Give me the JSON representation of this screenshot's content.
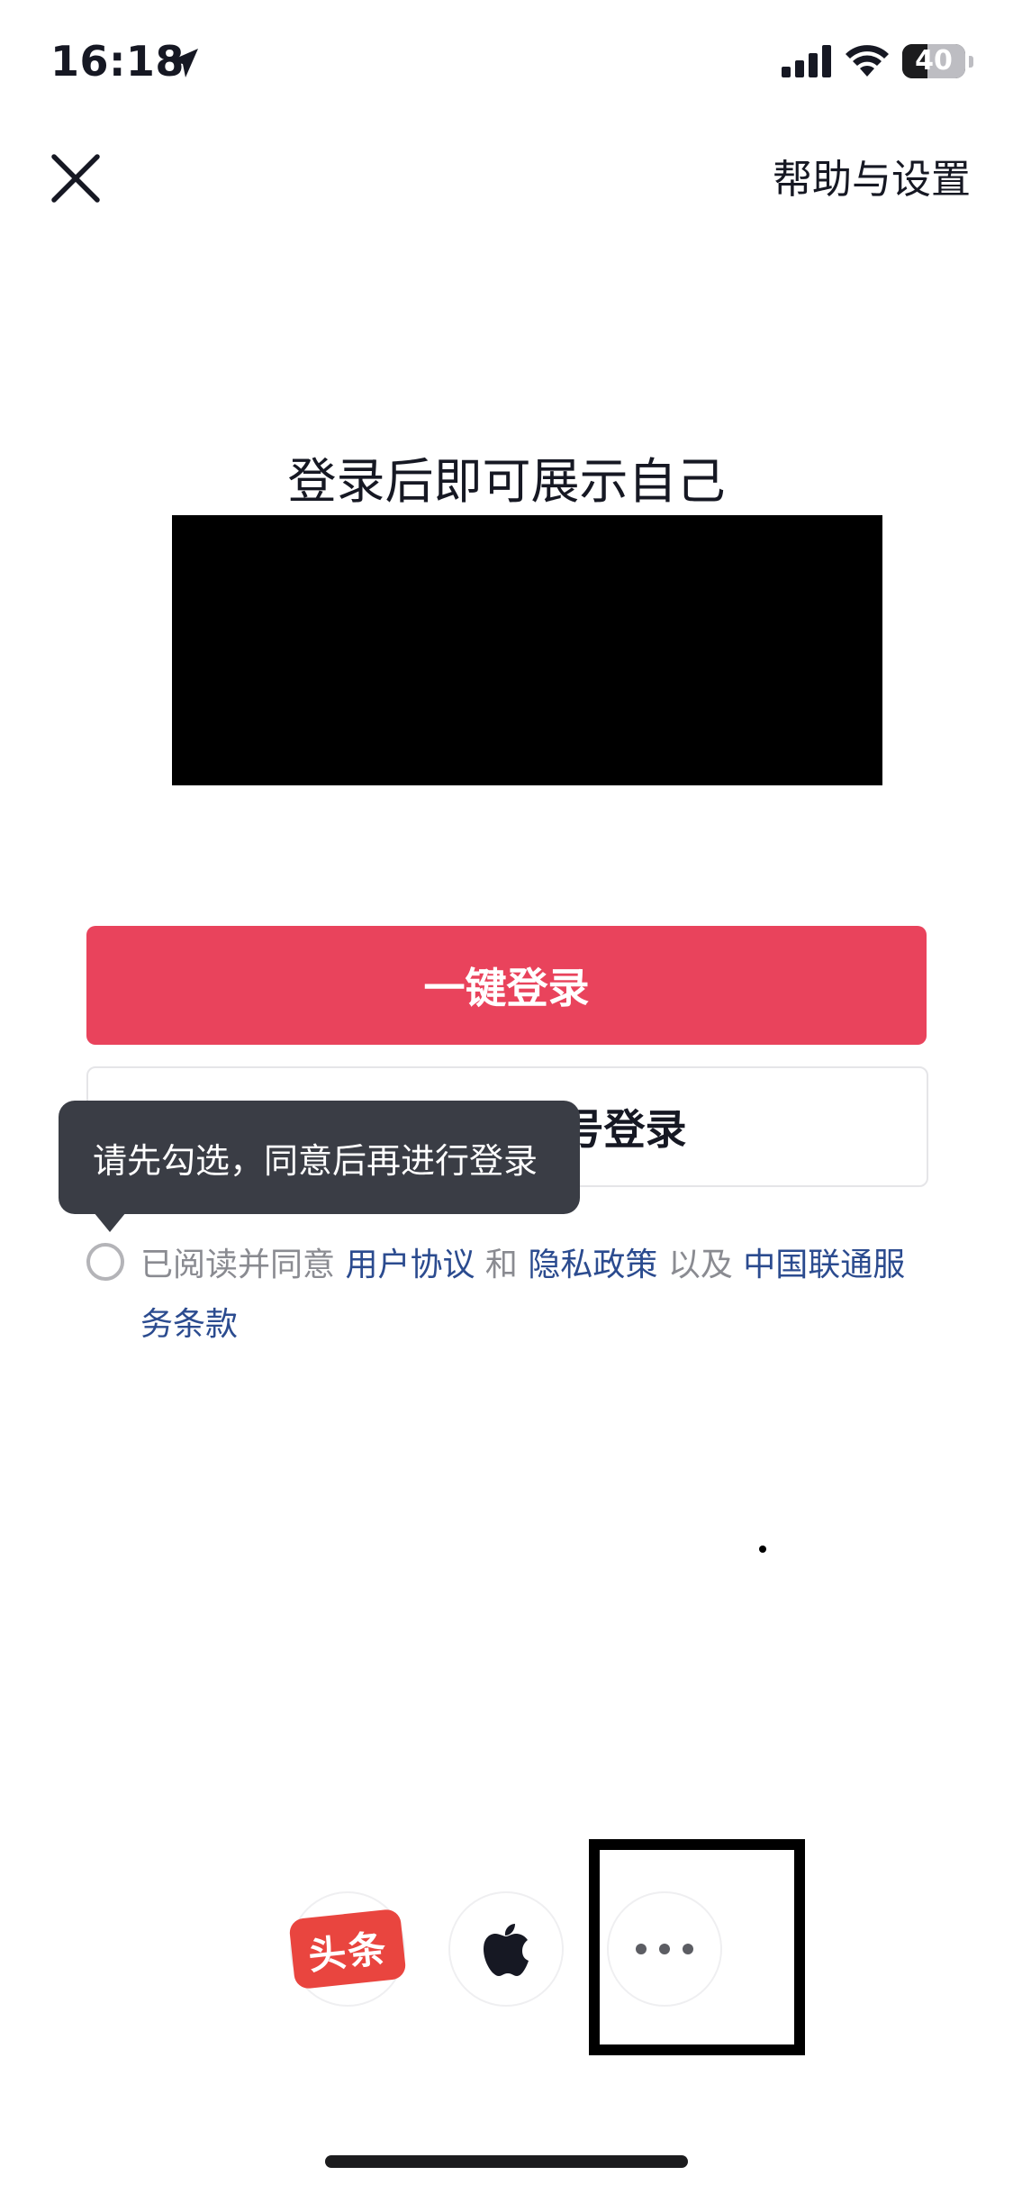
{
  "status_bar": {
    "time": "16:18",
    "battery_level": "40",
    "icons": [
      "location-arrow-icon",
      "cellular-signal-icon",
      "wifi-icon",
      "battery-icon"
    ]
  },
  "nav": {
    "close_icon": "close-icon",
    "help_settings": "帮助与设置"
  },
  "main": {
    "title": "登录后即可展示自己"
  },
  "buttons": {
    "one_click_login": "一键登录",
    "other_login": "号登录"
  },
  "tooltip": {
    "text": "请先勾选，同意后再进行登录"
  },
  "agreement": {
    "prefix": "已阅读并同意 ",
    "user_agreement": "用户协议",
    "and": " 和 ",
    "privacy_policy": "隐私政策",
    "as_well_as": " 以及 ",
    "carrier_terms": "中国联通服务条款"
  },
  "third_party": {
    "toutiao_label": "头条",
    "icons": [
      "toutiao-icon",
      "apple-icon",
      "more-icon"
    ]
  },
  "colors": {
    "primary": "#e9435c",
    "link": "#2b4b8f",
    "tooltip_bg": "#3a3d45",
    "toutiao_red": "#e9453f"
  }
}
